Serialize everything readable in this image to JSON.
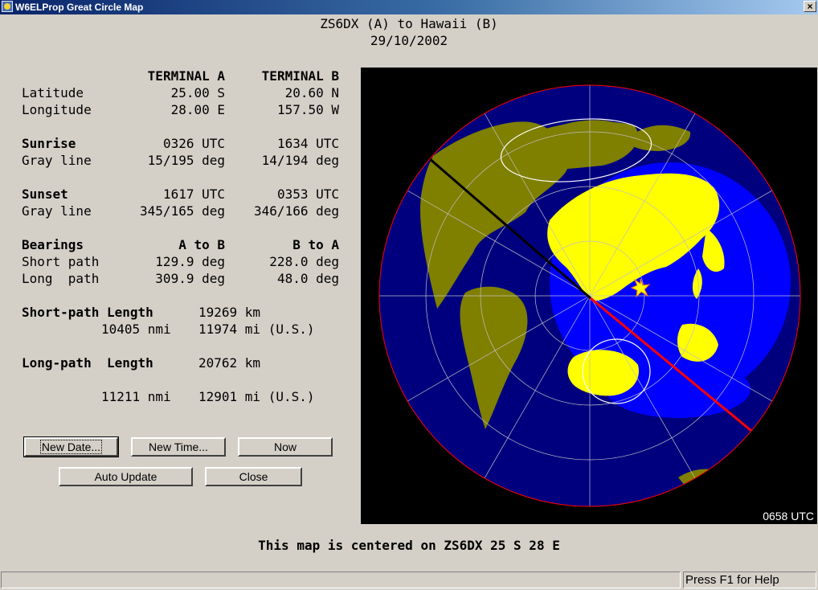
{
  "window": {
    "title": "W6ELProp Great Circle Map",
    "close_label": "×"
  },
  "header": {
    "line1": "ZS6DX (A) to Hawaii (B)",
    "line2": "29/10/2002"
  },
  "table": {
    "col_a": "TERMINAL A",
    "col_b": "TERMINAL B",
    "latitude": {
      "label": "Latitude",
      "a": "25.00 S",
      "b": "20.60 N"
    },
    "longitude": {
      "label": "Longitude",
      "a": "28.00 E",
      "b": "157.50 W"
    },
    "sunrise": {
      "label": "Sunrise",
      "a": "0326 UTC",
      "b": "1634 UTC"
    },
    "sunrise_gray": {
      "label": "Gray line",
      "a": "15/195 deg",
      "b": "14/194 deg"
    },
    "sunset": {
      "label": "Sunset",
      "a": "1617 UTC",
      "b": "0353 UTC"
    },
    "sunset_gray": {
      "label": "Gray line",
      "a": "345/165 deg",
      "b": "346/166 deg"
    },
    "bearings": {
      "label": "Bearings",
      "a": "A to B",
      "b": "B to A"
    },
    "short_path": {
      "label": "Short path",
      "a": "129.9 deg",
      "b": "228.0 deg"
    },
    "long_path": {
      "label": "Long  path",
      "a": "309.9 deg",
      "b": "48.0 deg"
    }
  },
  "lengths": {
    "short_label": "Short-path Length",
    "short_km": "19269 km",
    "short_nmi": "10405 nmi",
    "short_mi": "11974 mi (U.S.)",
    "long_label": "Long-path  Length",
    "long_km": "20762 km",
    "long_nmi": "11211 nmi",
    "long_mi": "12901 mi (U.S.)"
  },
  "buttons": {
    "new_date": "New Date...",
    "new_time": "New Time...",
    "now": "Now",
    "auto_update": "Auto Update",
    "close": "Close"
  },
  "map": {
    "time": "0658 UTC",
    "colors": {
      "ocean_day": "#0000ff",
      "ocean_night": "#00007f",
      "land_day": "#ffff00",
      "land_night": "#7f7f00",
      "short_path": "#ff0000",
      "long_path": "#000000",
      "horizon": "#ff0000"
    }
  },
  "footer": {
    "caption": "This map is centered on ZS6DX 25 S 28 E"
  },
  "status": {
    "help": "Press F1 for Help"
  }
}
